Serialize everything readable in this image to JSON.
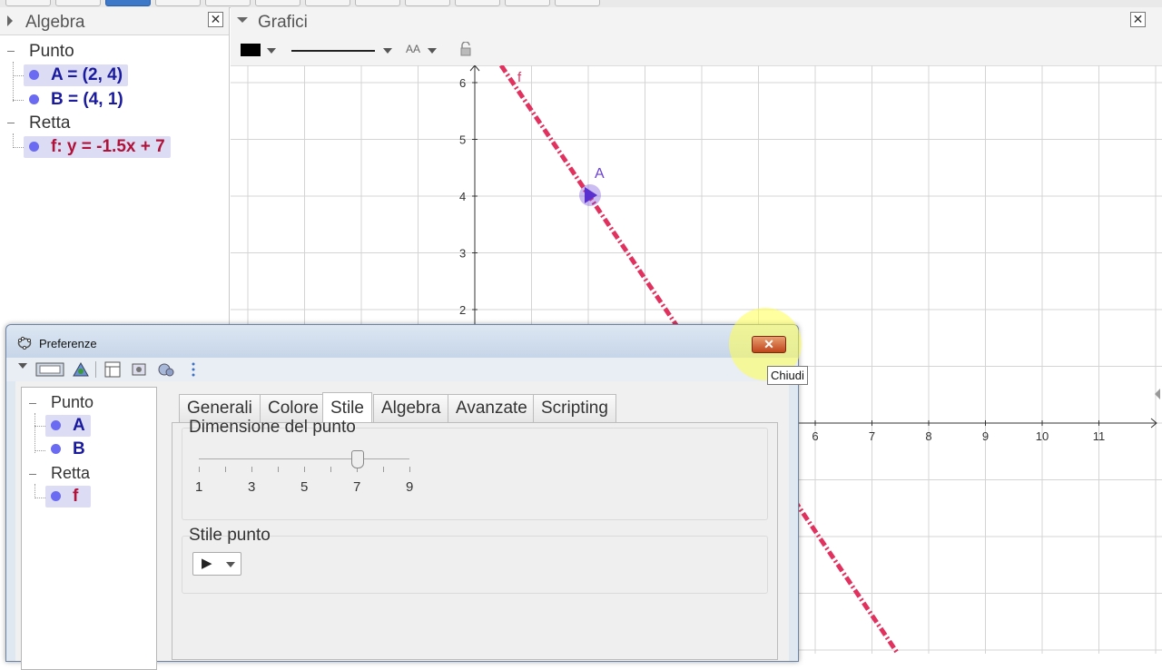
{
  "algebra": {
    "title": "Algebra",
    "close_glyph": "✕",
    "categories": [
      {
        "label": "Punto",
        "items": [
          {
            "text": "A = (2, 4)",
            "color": "#1a1a9e",
            "selected": true
          },
          {
            "text": "B = (4, 1)",
            "color": "#1a1a9e",
            "selected": false
          }
        ]
      },
      {
        "label": "Retta",
        "items": [
          {
            "text": "f: y = -1.5x + 7",
            "color": "#b0123a",
            "selected": true
          }
        ]
      }
    ]
  },
  "graphics": {
    "title": "Grafici",
    "close_glyph": "✕",
    "aa_label": "AA",
    "x_ticks": [
      "6",
      "7",
      "8",
      "9",
      "10",
      "11"
    ],
    "y_ticks": [
      "6",
      "5",
      "4",
      "3",
      "2"
    ],
    "line_label": "f",
    "point_label": "A",
    "line_color": "#e0315f",
    "point_color": "#6a3fd8"
  },
  "dialog": {
    "title": "Preferenze",
    "close_tooltip": "Chiudi",
    "tree": {
      "categories": [
        {
          "label": "Punto",
          "items": [
            "A",
            "B"
          ]
        },
        {
          "label": "Retta",
          "items": [
            "f"
          ]
        }
      ]
    },
    "tabs": [
      "Generali",
      "Colore",
      "Stile",
      "Algebra",
      "Avanzate",
      "Scripting"
    ],
    "selected_tab": "Stile",
    "point_size": {
      "label": "Dimensione del punto",
      "ticks": [
        "1",
        "3",
        "5",
        "7",
        "9"
      ],
      "value": 7
    },
    "point_style": {
      "label": "Stile punto",
      "selected": "▶"
    }
  }
}
